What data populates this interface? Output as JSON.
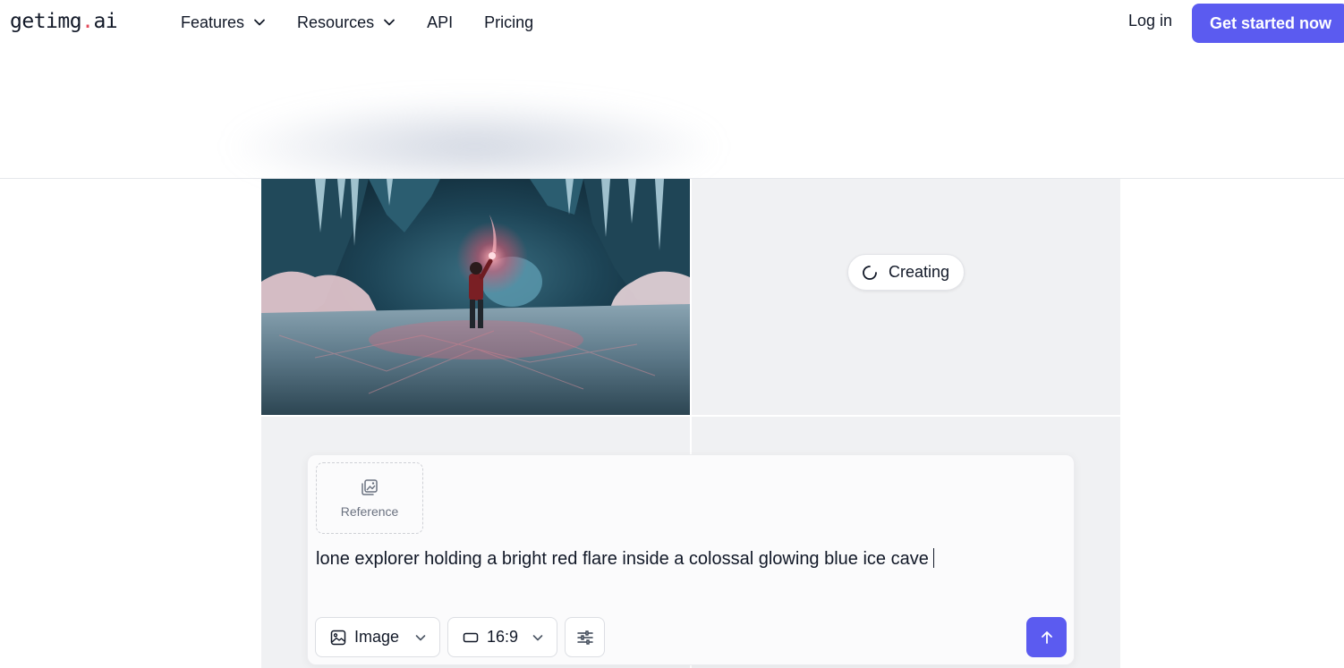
{
  "header": {
    "logo_main": "getimg",
    "logo_dot": ".",
    "logo_tail": "ai",
    "nav": [
      {
        "label": "Features",
        "has_dropdown": true
      },
      {
        "label": "Resources",
        "has_dropdown": true
      },
      {
        "label": "API",
        "has_dropdown": false
      },
      {
        "label": "Pricing",
        "has_dropdown": false
      }
    ],
    "login_label": "Log in",
    "cta_label": "Get started now"
  },
  "grid": {
    "creating_label": "Creating"
  },
  "prompt": {
    "reference_label": "Reference",
    "text": "lone explorer holding a bright red flare inside a colossal glowing blue ice cave",
    "type_label": "Image",
    "ratio_label": "16:9"
  },
  "colors": {
    "accent": "#5b5bf0",
    "logo_dot": "#e24a5a",
    "tile_bg": "#f0f1f3"
  },
  "icons": [
    "chevron-down-icon",
    "spinner-icon",
    "image-reference-icon",
    "image-icon",
    "aspect-ratio-icon",
    "sliders-icon",
    "arrow-up-icon"
  ]
}
